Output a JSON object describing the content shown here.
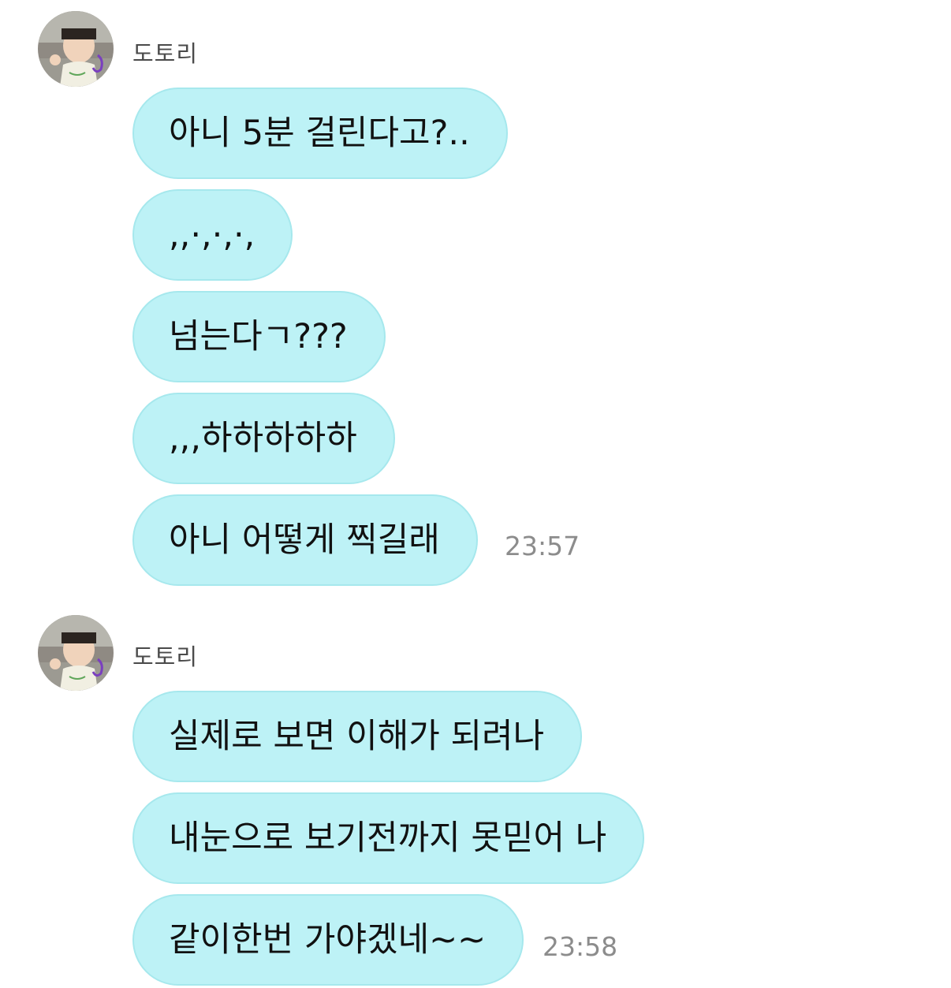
{
  "groups": [
    {
      "sender": "도토리",
      "avatar_icon": "child-photo-avatar",
      "messages": [
        "아니 5분 걸린다고?..",
        ",,·,·,·,",
        "넘는다ㄱ???",
        ",,,하하하하하",
        "아니 어떻게 찍길래"
      ],
      "timestamp": "23:57"
    },
    {
      "sender": "도토리",
      "avatar_icon": "child-photo-avatar",
      "messages": [
        "실제로 보면 이해가 되려나",
        "내눈으로 보기전까지 못믿어 나",
        "같이한번 가야겠네~~"
      ],
      "timestamp": "23:58"
    }
  ],
  "colors": {
    "bubble_bg": "#bdf2f6",
    "bubble_border": "#a6e8ed",
    "timestamp": "#8c8c8c",
    "sender": "#4a4a4a"
  }
}
